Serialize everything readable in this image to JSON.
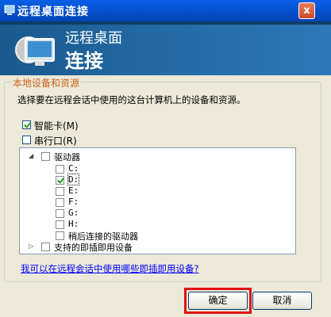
{
  "window": {
    "title": "远程桌面连接",
    "close_label": "x"
  },
  "banner": {
    "title": "远程桌面",
    "subtitle": "连接"
  },
  "group": {
    "label": "本地设备和资源",
    "description": "选择要在远程会话中使用的这台计算机上的设备和资源。"
  },
  "options": {
    "smartcard": {
      "label": "智能卡(M)",
      "checked": true
    },
    "serial": {
      "label": "串行口(R)",
      "checked": false
    }
  },
  "tree": {
    "drives_label": "驱动器",
    "drives": [
      {
        "label": "C:",
        "checked": false
      },
      {
        "label": "D:",
        "checked": true
      },
      {
        "label": "E:",
        "checked": false
      },
      {
        "label": "F:",
        "checked": false
      },
      {
        "label": "G:",
        "checked": false
      },
      {
        "label": "H:",
        "checked": false
      }
    ],
    "later_drives_label": "稍后连接的驱动器",
    "pnp_label": "支持的即插即用设备"
  },
  "link": {
    "text": "我可以在远程会话中使用哪些即插即用设备?"
  },
  "buttons": {
    "ok": "确定",
    "cancel": "取消"
  },
  "colors": {
    "title_bar": "#0554d4",
    "group_label": "#c8641e",
    "highlight": "#e01010"
  }
}
